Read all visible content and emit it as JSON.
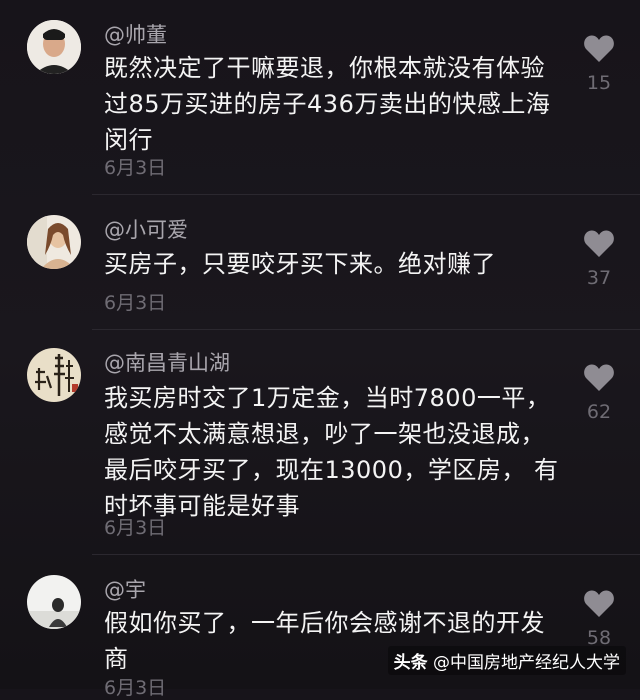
{
  "comments": [
    {
      "username": "@帅董",
      "text": "既然决定了干嘛要退，你根本就没有体验过85万买进的房子436万卖出的快感上海闵行",
      "date": "6月3日",
      "likes": "15",
      "avatar": "person-avatar"
    },
    {
      "username": "@小可爱",
      "text": "买房子，只要咬牙买下来。绝对赚了",
      "date": "6月3日",
      "likes": "37",
      "avatar": "person-avatar"
    },
    {
      "username": "@南昌青山湖",
      "text": "我买房时交了1万定金，当时7800一平， 感觉不太满意想退，吵了一架也没退成，最后咬牙买了，现在13000，学区房， 有时坏事可能是好事",
      "date": "6月3日",
      "likes": "62",
      "avatar": "calligraphy-avatar"
    },
    {
      "username": "@宇",
      "text": "假如你买了，一年后你会感谢不退的开发商",
      "date": "6月3日",
      "likes": "58",
      "avatar": "person-avatar"
    }
  ],
  "watermark": {
    "brand": "头条",
    "account": "@中国房地产经纪人大学"
  },
  "colors": {
    "background": "#17141a",
    "text": "#f4f4f4",
    "username": "#a9a6ad",
    "muted": "#6f6c74"
  },
  "icons": {
    "like": "heart-icon"
  }
}
